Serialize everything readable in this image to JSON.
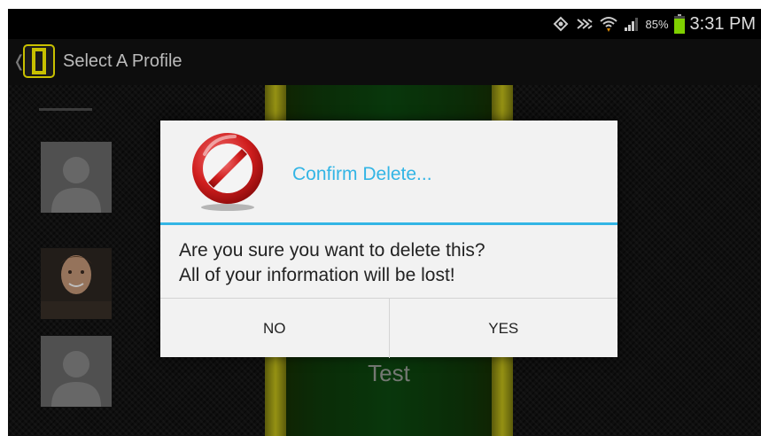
{
  "status_bar": {
    "icons": [
      "ringer-icon",
      "nfc-icon",
      "wifi-icon",
      "signal-icon",
      "battery-icon"
    ],
    "battery_percent": "85%",
    "time": "3:31 PM"
  },
  "action_bar": {
    "title": "Select A Profile",
    "up_icon": "chevron-left-icon",
    "app_icon": "app-logo-icon"
  },
  "background": {
    "profile_name": "Test",
    "avatars": [
      "default-avatar",
      "photo-avatar",
      "default-avatar"
    ]
  },
  "dialog": {
    "title": "Confirm Delete...",
    "icon": "no-entry-icon",
    "message_line1": "Are you sure you want to delete this?",
    "message_line2": "All of your information will be lost!",
    "no_label": "NO",
    "yes_label": "YES"
  },
  "colors": {
    "accent": "#33b5e5",
    "panel_rail": "#c7c21a",
    "dialog_bg": "#f2f2f2"
  }
}
